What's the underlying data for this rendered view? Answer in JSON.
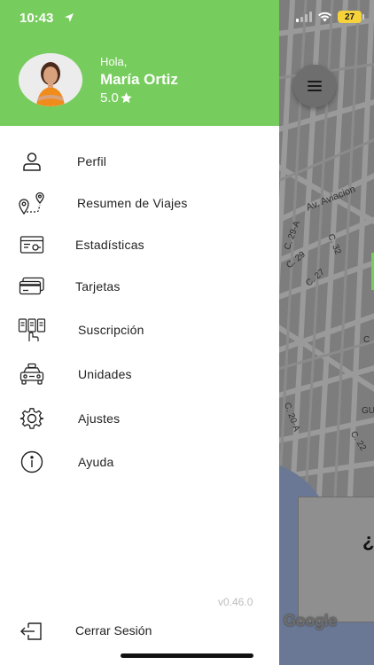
{
  "status_bar": {
    "time": "10:43",
    "battery": "27"
  },
  "drawer": {
    "greeting": "Hola,",
    "user_name": "María Ortiz",
    "rating": "5.0",
    "menu": [
      {
        "label": "Perfil",
        "icon": "user-icon"
      },
      {
        "label": "Resumen de Viajes",
        "icon": "route-pin-icon"
      },
      {
        "label": "Estadísticas",
        "icon": "stats-card-icon"
      },
      {
        "label": "Tarjetas",
        "icon": "credit-cards-icon"
      },
      {
        "label": "Suscripción",
        "icon": "subscription-icon"
      },
      {
        "label": "Unidades",
        "icon": "taxi-icon"
      },
      {
        "label": "Ajustes",
        "icon": "gear-icon"
      },
      {
        "label": "Ayuda",
        "icon": "info-icon"
      }
    ],
    "version": "v0.46.0",
    "logout_label": "Cerrar Sesión"
  },
  "map": {
    "labels": [
      "Av. Aviacion",
      "C. 29-A",
      "C. 32",
      "C. 29",
      "C. 27",
      "C. 20-A",
      "C. 22",
      "GU",
      "C"
    ],
    "card_text": "¿",
    "attribution": "Google"
  },
  "colors": {
    "header": "#77cc5e",
    "map": "#7d7d7d"
  }
}
